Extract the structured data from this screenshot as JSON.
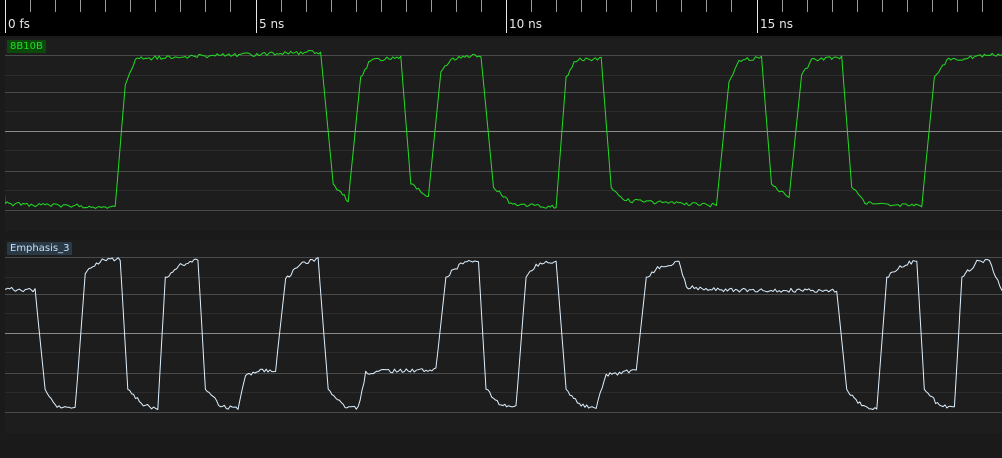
{
  "ruler": {
    "labels": [
      {
        "time_ns": 0,
        "text": "0 fs"
      },
      {
        "time_ns": 5,
        "text": "5 ns"
      },
      {
        "time_ns": 10,
        "text": "10 ns"
      },
      {
        "time_ns": 15,
        "text": "15 ns"
      }
    ],
    "minor_step_ns": 0.5
  },
  "chart_data": {
    "type": "line",
    "title": "",
    "xlabel": "",
    "ylabel": "",
    "xunit": "ns",
    "xlim": [
      -0.1,
      19.9
    ],
    "grid": true,
    "series": [
      {
        "name": "8B10B",
        "color": "#22dd22",
        "label_bg": "#0c4a0c",
        "label_fg": "#22dd22",
        "ylim": [
          0,
          1
        ],
        "points": [
          [
            -0.1,
            0.72
          ],
          [
            0.0,
            0.08
          ],
          [
            2.2,
            0.06
          ],
          [
            2.4,
            0.8
          ],
          [
            2.6,
            0.96
          ],
          [
            6.3,
            1.0
          ],
          [
            6.55,
            0.2
          ],
          [
            6.85,
            0.1
          ],
          [
            7.1,
            0.85
          ],
          [
            7.3,
            0.95
          ],
          [
            7.9,
            0.97
          ],
          [
            8.1,
            0.2
          ],
          [
            8.45,
            0.12
          ],
          [
            8.7,
            0.88
          ],
          [
            8.9,
            0.96
          ],
          [
            9.5,
            0.98
          ],
          [
            9.75,
            0.18
          ],
          [
            10.1,
            0.08
          ],
          [
            11.0,
            0.06
          ],
          [
            11.2,
            0.85
          ],
          [
            11.4,
            0.95
          ],
          [
            11.9,
            0.96
          ],
          [
            12.1,
            0.18
          ],
          [
            12.4,
            0.1
          ],
          [
            14.2,
            0.07
          ],
          [
            14.45,
            0.82
          ],
          [
            14.65,
            0.95
          ],
          [
            15.1,
            0.97
          ],
          [
            15.3,
            0.2
          ],
          [
            15.65,
            0.12
          ],
          [
            15.9,
            0.86
          ],
          [
            16.1,
            0.95
          ],
          [
            16.7,
            0.97
          ],
          [
            16.9,
            0.18
          ],
          [
            17.2,
            0.08
          ],
          [
            18.3,
            0.07
          ],
          [
            18.55,
            0.85
          ],
          [
            18.8,
            0.95
          ],
          [
            19.9,
            0.99
          ]
        ]
      },
      {
        "name": "Emphasis_3",
        "color": "#ddf0ff",
        "label_bg": "#2b3944",
        "label_fg": "#bfe0ff",
        "ylim": [
          0,
          1
        ],
        "points": [
          [
            -0.1,
            0.79
          ],
          [
            0.6,
            0.78
          ],
          [
            0.8,
            0.18
          ],
          [
            1.0,
            0.08
          ],
          [
            1.4,
            0.06
          ],
          [
            1.6,
            0.88
          ],
          [
            1.9,
            0.96
          ],
          [
            2.3,
            0.97
          ],
          [
            2.45,
            0.18
          ],
          [
            2.8,
            0.08
          ],
          [
            3.05,
            0.06
          ],
          [
            3.2,
            0.86
          ],
          [
            3.5,
            0.93
          ],
          [
            3.85,
            0.97
          ],
          [
            4.0,
            0.18
          ],
          [
            4.3,
            0.08
          ],
          [
            4.65,
            0.06
          ],
          [
            4.8,
            0.27
          ],
          [
            5.1,
            0.29
          ],
          [
            5.4,
            0.3
          ],
          [
            5.6,
            0.85
          ],
          [
            5.9,
            0.94
          ],
          [
            6.25,
            0.97
          ],
          [
            6.45,
            0.18
          ],
          [
            6.75,
            0.08
          ],
          [
            7.05,
            0.07
          ],
          [
            7.2,
            0.28
          ],
          [
            7.5,
            0.29
          ],
          [
            8.6,
            0.3
          ],
          [
            8.8,
            0.86
          ],
          [
            9.1,
            0.94
          ],
          [
            9.45,
            0.96
          ],
          [
            9.6,
            0.18
          ],
          [
            9.9,
            0.08
          ],
          [
            10.2,
            0.07
          ],
          [
            10.4,
            0.86
          ],
          [
            10.6,
            0.93
          ],
          [
            11.0,
            0.96
          ],
          [
            11.2,
            0.18
          ],
          [
            11.5,
            0.08
          ],
          [
            11.8,
            0.07
          ],
          [
            12.0,
            0.27
          ],
          [
            12.3,
            0.28
          ],
          [
            12.6,
            0.3
          ],
          [
            12.8,
            0.86
          ],
          [
            13.1,
            0.93
          ],
          [
            13.45,
            0.95
          ],
          [
            13.6,
            0.8
          ],
          [
            14.5,
            0.78
          ],
          [
            16.6,
            0.78
          ],
          [
            16.8,
            0.18
          ],
          [
            17.1,
            0.08
          ],
          [
            17.4,
            0.06
          ],
          [
            17.6,
            0.86
          ],
          [
            17.9,
            0.93
          ],
          [
            18.2,
            0.96
          ],
          [
            18.35,
            0.18
          ],
          [
            18.65,
            0.08
          ],
          [
            18.95,
            0.07
          ],
          [
            19.1,
            0.86
          ],
          [
            19.4,
            0.95
          ],
          [
            19.65,
            0.96
          ],
          [
            19.9,
            0.78
          ]
        ]
      }
    ]
  }
}
